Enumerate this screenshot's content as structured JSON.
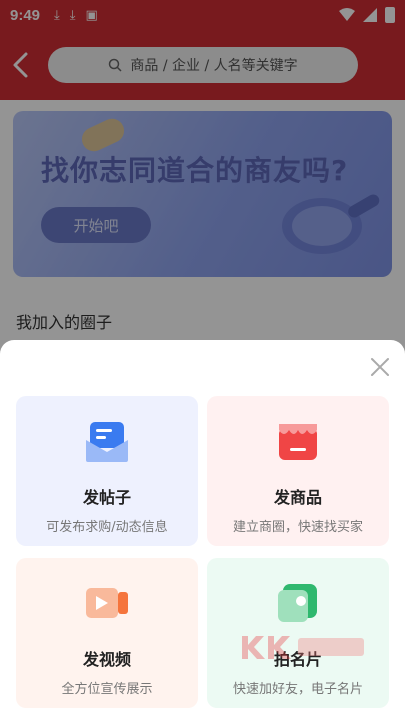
{
  "status_bar": {
    "time": "9:49",
    "left_icons": [
      "download-icon",
      "download-icon",
      "keyboard-icon"
    ],
    "right_icons": [
      "wifi-icon",
      "signal-icon",
      "battery-icon"
    ]
  },
  "header": {
    "search_placeholder": "商品 / 企业 / 人名等关键字"
  },
  "banner": {
    "title": "找你志同道合的商友吗?",
    "button_label": "开始吧"
  },
  "section": {
    "label": "我加入的圈子"
  },
  "sheet": {
    "cards": [
      {
        "title": "发帖子",
        "subtitle": "可发布求购/动态信息",
        "icon": "post-icon",
        "color": "#3a7bf0"
      },
      {
        "title": "发商品",
        "subtitle": "建立商圈，快速找买家",
        "icon": "shop-icon",
        "color": "#f04545"
      },
      {
        "title": "发视频",
        "subtitle": "全方位宣传展示",
        "icon": "video-icon",
        "color": "#f5743c"
      },
      {
        "title": "拍名片",
        "subtitle": "快速加好友，电子名片",
        "icon": "card-photo-icon",
        "color": "#2fb86e"
      }
    ]
  },
  "colors": {
    "brand": "#cf2e34"
  }
}
